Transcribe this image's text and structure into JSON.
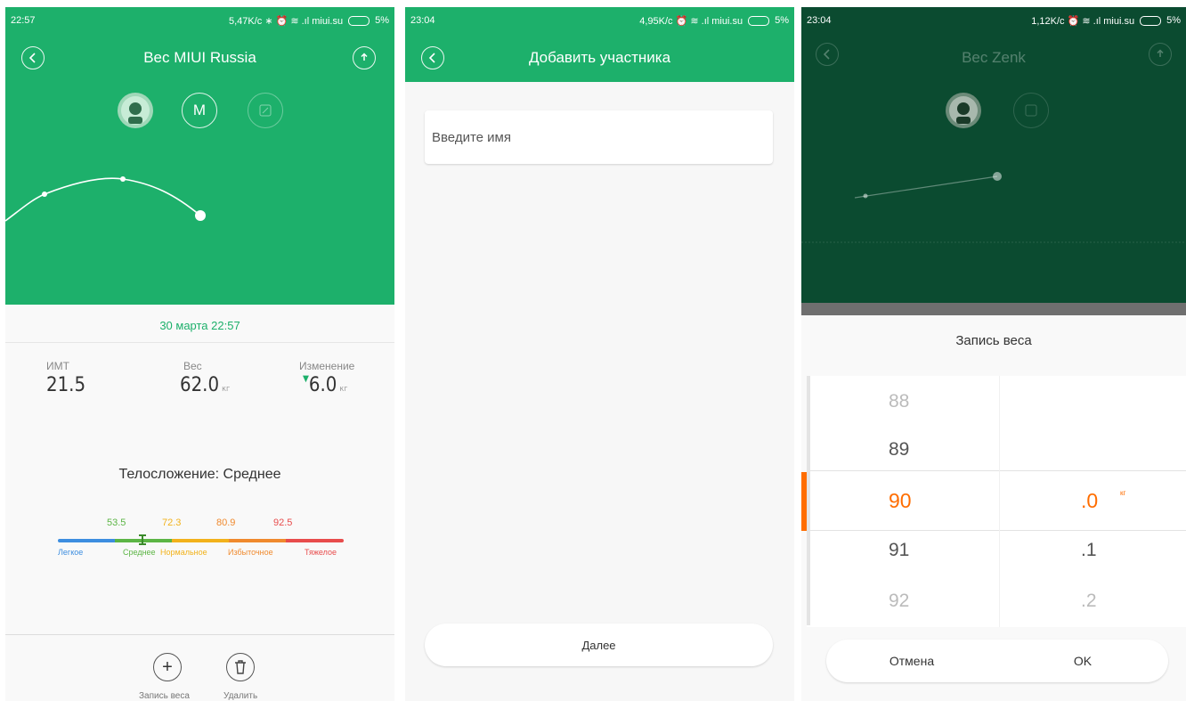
{
  "screen1": {
    "status": {
      "time": "22:57",
      "right": "5,47K/c ∗ ⏰ ≋ .ıl miui.su",
      "battery": "5%"
    },
    "title": "Вес MIUI Russia",
    "avatar_letter": "M",
    "date": "30 марта 22:57",
    "stats": {
      "bmi_label": "ИМТ",
      "bmi_value": "21.5",
      "weight_label": "Вес",
      "weight_value": "62.0",
      "weight_unit": "кг",
      "change_label": "Изменение",
      "change_value": "6.0",
      "change_unit": "кг"
    },
    "body_type": "Телосложение: Среднее",
    "scale": {
      "thresholds": [
        "53.5",
        "72.3",
        "80.9",
        "92.5"
      ],
      "labels": [
        "Легкое",
        "Среднее",
        "Нормальное",
        "Избыточное",
        "Тяжелое"
      ],
      "colors": [
        "#3d8ee0",
        "#5cb545",
        "#f2b21b",
        "#f08a2e",
        "#e84c4c"
      ]
    },
    "actions": {
      "add_label": "Запись веса",
      "delete_label": "Удалить"
    }
  },
  "screen2": {
    "status": {
      "time": "23:04",
      "right": "4,95K/c ⏰ ≋ .ıl miui.su",
      "battery": "5%"
    },
    "title": "Добавить участника",
    "name_placeholder": "Введите имя",
    "next_label": "Далее"
  },
  "screen3": {
    "status": {
      "time": "23:04",
      "right": "1,12K/c ⏰ ≋ .ıl miui.su",
      "battery": "5%"
    },
    "title": "Вес Zenk",
    "sheet_title": "Запись веса",
    "picker_integers": [
      "88",
      "89",
      "90",
      "91",
      "92"
    ],
    "picker_decimals": [
      "",
      "",
      ".0",
      ".1",
      ".2"
    ],
    "unit": "кг",
    "cancel_label": "Отмена",
    "ok_label": "OK"
  },
  "colors": {
    "green": "#1db06b",
    "dark_green": "#0b4b30",
    "accent_orange": "#ff6d00"
  }
}
